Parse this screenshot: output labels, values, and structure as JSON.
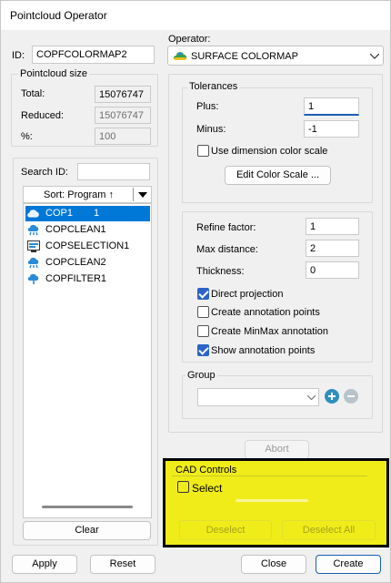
{
  "window": {
    "title": "Pointcloud Operator"
  },
  "id_field": {
    "label": "ID:",
    "value": "COPFCOLORMAP2"
  },
  "size_group": {
    "title": "Pointcloud size",
    "total_label": "Total:",
    "total_value": "15076747",
    "reduced_label": "Reduced:",
    "reduced_value": "15076747",
    "percent_label": "%:",
    "percent_value": "100"
  },
  "list_panel": {
    "search_label": "Search ID:",
    "search_value": "",
    "sort_label": "Sort: Program ↑",
    "items": [
      {
        "name": "COP1",
        "number": "1",
        "icon": "cloud-icon",
        "selected": true
      },
      {
        "name": "COPCLEAN1",
        "number": "",
        "icon": "clean-cloud-icon",
        "selected": false
      },
      {
        "name": "COPSELECTION1",
        "number": "",
        "icon": "selection-icon",
        "selected": false
      },
      {
        "name": "COPCLEAN2",
        "number": "",
        "icon": "clean-cloud-icon",
        "selected": false
      },
      {
        "name": "COPFILTER1",
        "number": "",
        "icon": "filter-cloud-icon",
        "selected": false
      }
    ],
    "clear_label": "Clear"
  },
  "operator": {
    "label": "Operator:",
    "value": "SURFACE COLORMAP"
  },
  "tolerances": {
    "title": "Tolerances",
    "plus_label": "Plus:",
    "plus_value": "1",
    "minus_label": "Minus:",
    "minus_value": "-1",
    "dim_color_label": "Use dimension color scale",
    "dim_color_checked": false,
    "edit_color_label": "Edit Color Scale ..."
  },
  "params": {
    "refine_label": "Refine factor:",
    "refine_value": "1",
    "maxdist_label": "Max distance:",
    "maxdist_value": "2",
    "thickness_label": "Thickness:",
    "thickness_value": "0",
    "direct_label": "Direct projection",
    "direct_checked": true,
    "create_ann_label": "Create annotation points",
    "create_ann_checked": false,
    "minmax_label": "Create MinMax annotation",
    "minmax_checked": false,
    "show_ann_label": "Show annotation points",
    "show_ann_checked": true
  },
  "group_section": {
    "title": "Group",
    "value": ""
  },
  "abort_label": "Abort",
  "cad": {
    "title": "CAD Controls",
    "select_label": "Select",
    "select_checked": false,
    "deselect_label": "Deselect",
    "deselect_all_label": "Deselect All"
  },
  "footer": {
    "apply_label": "Apply",
    "reset_label": "Reset",
    "close_label": "Close",
    "create_label": "Create"
  },
  "colors": {
    "accent": "#0078d7",
    "highlight": "#f0ec1a",
    "add_button": "#2f8fbf"
  }
}
